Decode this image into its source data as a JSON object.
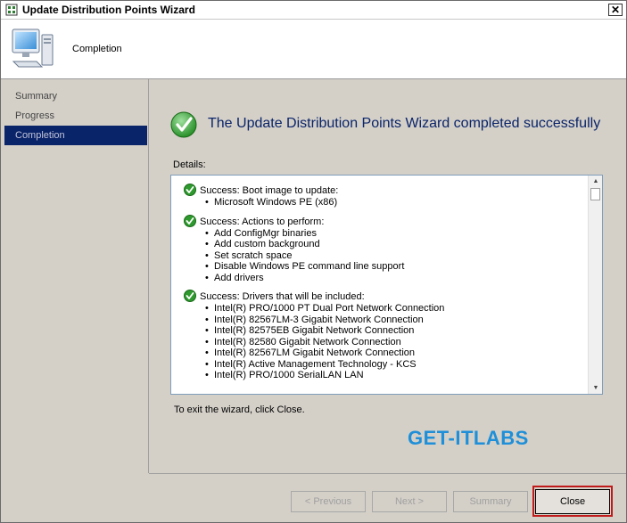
{
  "window": {
    "title": "Update Distribution Points Wizard",
    "close_glyph": "✕"
  },
  "header": {
    "title": "Completion",
    "icon": "computer-icon"
  },
  "nav": {
    "items": [
      "Summary",
      "Progress",
      "Completion"
    ],
    "active": "Completion"
  },
  "main": {
    "status_icon": "success-check-icon",
    "success_title": "The Update Distribution Points Wizard completed successfully",
    "details_label": "Details:",
    "details": [
      {
        "heading": "Success: Boot image to update:",
        "items": [
          "Microsoft Windows PE (x86)"
        ]
      },
      {
        "heading": "Success: Actions to perform:",
        "items": [
          "Add ConfigMgr binaries",
          "Add custom background",
          "Set scratch space",
          "Disable Windows PE command line support",
          "Add drivers"
        ]
      },
      {
        "heading": "Success: Drivers that will be included:",
        "items": [
          "Intel(R) PRO/1000 PT Dual Port Network Connection",
          "Intel(R) 82567LM-3 Gigabit Network Connection",
          "Intel(R) 82575EB Gigabit Network Connection",
          "Intel(R) 82580 Gigabit Network Connection",
          "Intel(R) 82567LM Gigabit Network Connection",
          "Intel(R) Active Management Technology - KCS",
          "Intel(R) PRO/1000 SerialLAN LAN"
        ]
      }
    ],
    "exit_text": "To exit the wizard, click Close.",
    "watermark": "GET-ITLABS"
  },
  "buttons": {
    "previous": "< Previous",
    "next": "Next >",
    "summary": "Summary",
    "close": "Close"
  },
  "colors": {
    "accent": "#0a246a",
    "watermark": "#1e8fd8",
    "highlight": "#c01a1a",
    "success": "#2e9a2e"
  }
}
